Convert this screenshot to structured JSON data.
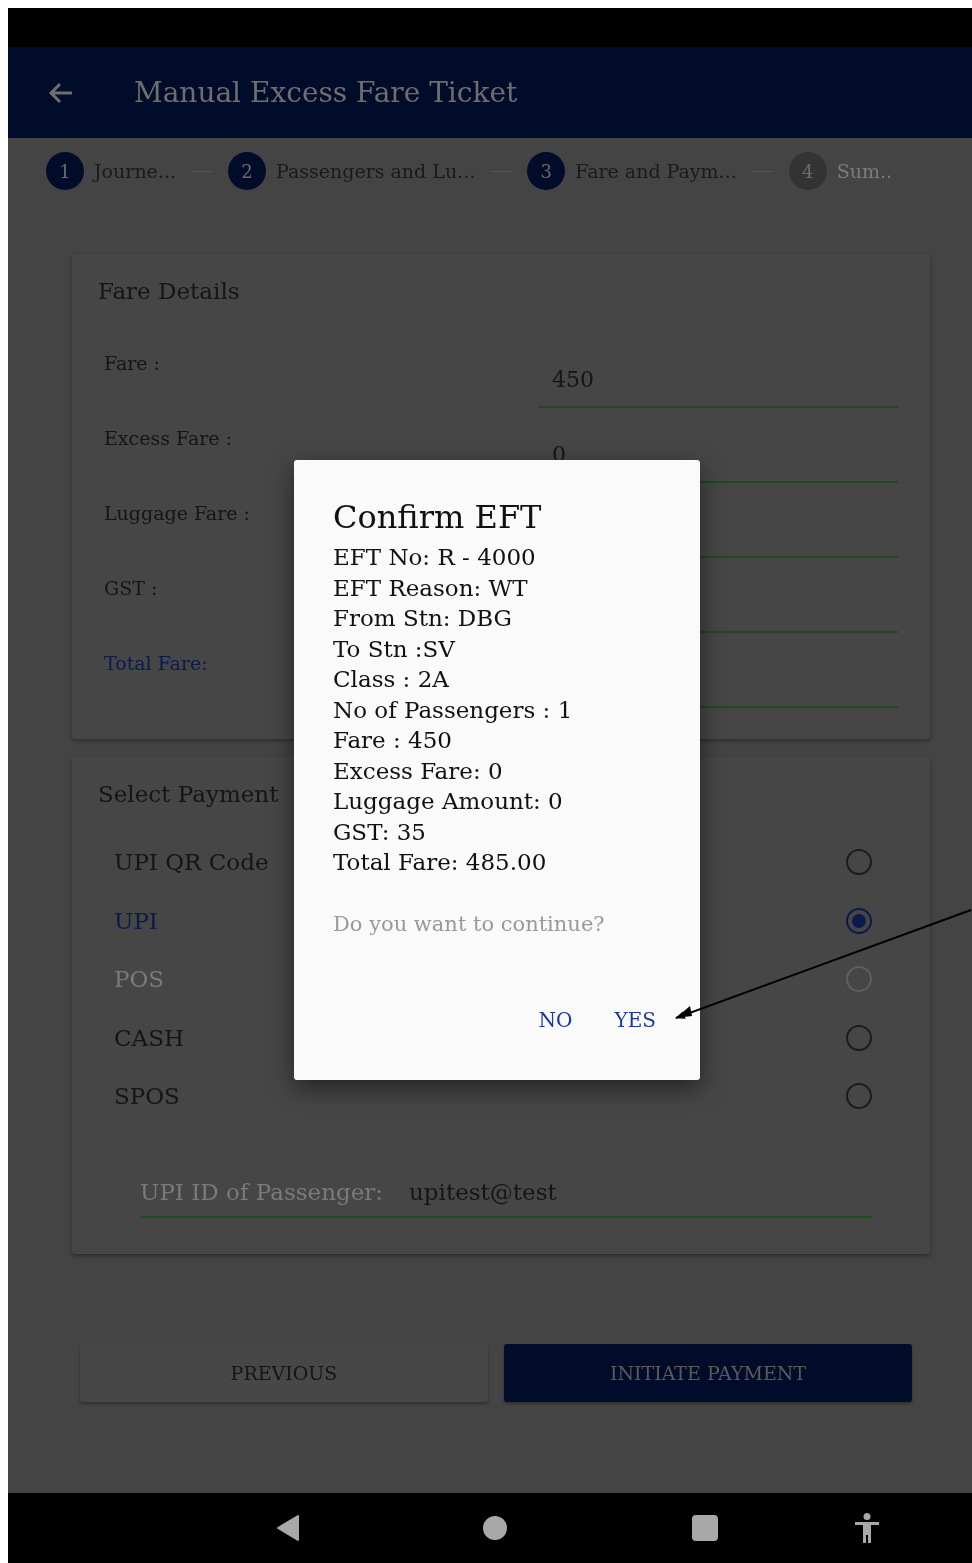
{
  "app_bar": {
    "title": "Manual Excess Fare Ticket"
  },
  "steps": [
    {
      "number": "1",
      "label": "Journe...",
      "active": true
    },
    {
      "number": "2",
      "label": "Passengers and Lu...",
      "active": true
    },
    {
      "number": "3",
      "label": "Fare and Paym...",
      "active": true
    },
    {
      "number": "4",
      "label": "Sum..",
      "active": false
    }
  ],
  "fare_details": {
    "title": "Fare Details",
    "rows": [
      {
        "label": "Fare :",
        "value": "450",
        "kind": "plain"
      },
      {
        "label": "Excess Fare :",
        "value": "0",
        "kind": "plain"
      },
      {
        "label": "Luggage Fare :",
        "kind": "plain"
      },
      {
        "label": "GST :",
        "kind": "plain"
      },
      {
        "label": "Total Fare:",
        "kind": "total"
      }
    ]
  },
  "payment": {
    "title": "Select Payment",
    "options": [
      {
        "label": "UPI QR Code",
        "selected": false,
        "disabled": false
      },
      {
        "label": "UPI",
        "selected": true,
        "disabled": false
      },
      {
        "label": "POS",
        "selected": false,
        "disabled": true
      },
      {
        "label": "CASH",
        "selected": false,
        "disabled": false
      },
      {
        "label": "SPOS",
        "selected": false,
        "disabled": false
      }
    ],
    "upi_field": {
      "label": "UPI ID of Passenger:",
      "value": "upitest@test"
    }
  },
  "buttons": [
    {
      "label": "PREVIOUS",
      "kind": "secondary"
    },
    {
      "label": "INITIATE PAYMENT",
      "kind": "primary"
    }
  ],
  "dialog": {
    "title": "Confirm EFT",
    "details": [
      "EFT No: R - 4000",
      "EFT Reason: WT",
      "From Stn: DBG",
      "To Stn :SV",
      "Class : 2A",
      "No of Passengers : 1",
      "Fare : 450",
      "Excess Fare: 0",
      "Luggage Amount: 0",
      "GST: 35",
      "Total Fare: 485.00"
    ],
    "question": "Do you want to continue?",
    "actions": [
      "NO",
      "YES"
    ]
  }
}
